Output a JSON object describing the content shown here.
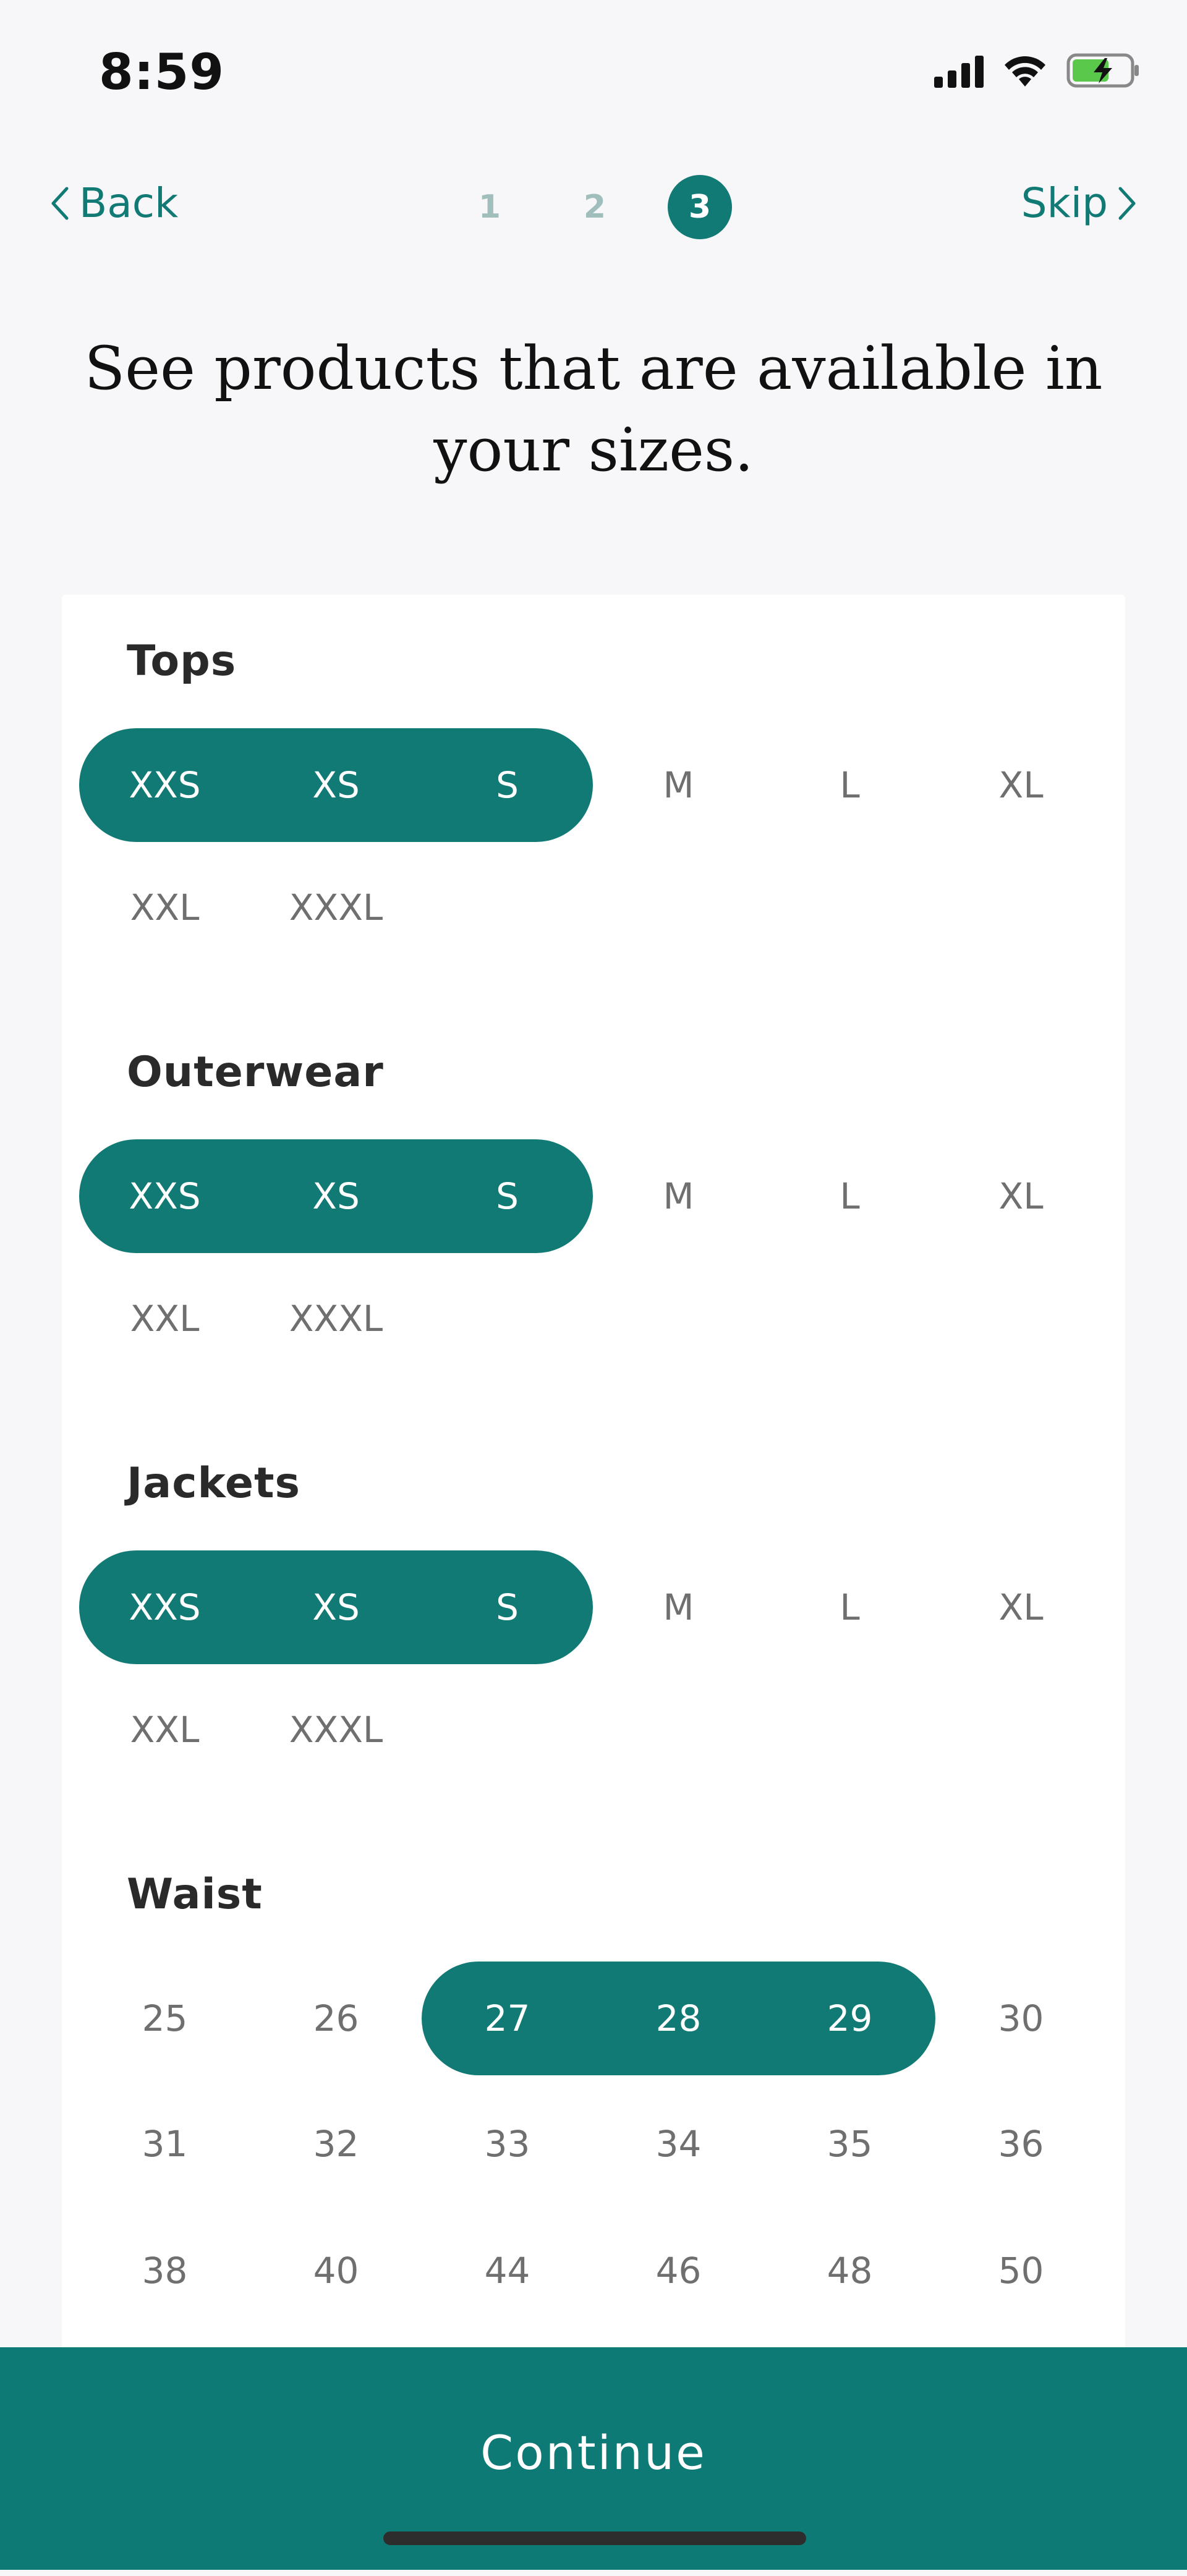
{
  "status_bar": {
    "time": "8:59"
  },
  "nav": {
    "back_label": "Back",
    "skip_label": "Skip",
    "steps": [
      "1",
      "2",
      "3"
    ],
    "current_step": 3
  },
  "title": "See products that are available in your sizes.",
  "sections": {
    "tops": {
      "title": "Tops",
      "options": [
        "XXS",
        "XS",
        "S",
        "M",
        "L",
        "XL",
        "XXL",
        "XXXL"
      ],
      "selected": [
        "XXS",
        "XS",
        "S"
      ]
    },
    "outerwear": {
      "title": "Outerwear",
      "options": [
        "XXS",
        "XS",
        "S",
        "M",
        "L",
        "XL",
        "XXL",
        "XXXL"
      ],
      "selected": [
        "XXS",
        "XS",
        "S"
      ]
    },
    "jackets": {
      "title": "Jackets",
      "options": [
        "XXS",
        "XS",
        "S",
        "M",
        "L",
        "XL",
        "XXL",
        "XXXL"
      ],
      "selected": [
        "XXS",
        "XS",
        "S"
      ]
    },
    "waist": {
      "title": "Waist",
      "options": [
        "25",
        "26",
        "27",
        "28",
        "29",
        "30",
        "31",
        "32",
        "33",
        "34",
        "35",
        "36",
        "38",
        "40",
        "44",
        "46",
        "48",
        "50"
      ],
      "selected": [
        "27",
        "28",
        "29"
      ]
    }
  },
  "continue_label": "Continue",
  "colors": {
    "accent": "#117a74",
    "background": "#f7f7f9",
    "card": "#ffffff",
    "unselected_text": "#6f6f6f"
  }
}
